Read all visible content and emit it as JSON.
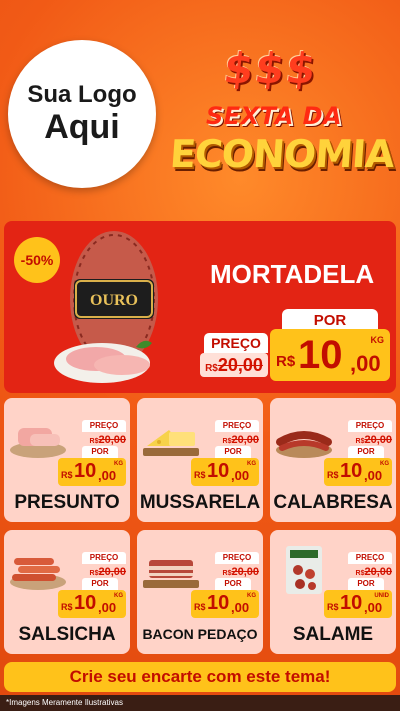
{
  "logo": {
    "line1": "Sua Logo",
    "line2": "Aqui"
  },
  "headline": {
    "symbols": [
      "$",
      "$",
      "$"
    ],
    "line1": "SEXTA DA",
    "line2": "ECONOMIA"
  },
  "hero": {
    "discount": "-50%",
    "brand": "OURO",
    "product": "MORTADELA",
    "preco_label": "PREÇO",
    "old_currency": "R$",
    "old_price": "20,00",
    "por_label": "POR",
    "currency": "R$",
    "price_int": "10",
    "price_cents": ",00",
    "unit": "KG"
  },
  "cards": [
    {
      "name": "PRESUNTO",
      "preco_label": "PREÇO",
      "old_currency": "R$",
      "old_price": "20,00",
      "por_label": "POR",
      "currency": "R$",
      "price_int": "10",
      "price_cents": ",00",
      "unit": "KG"
    },
    {
      "name": "MUSSARELA",
      "preco_label": "PREÇO",
      "old_currency": "R$",
      "old_price": "20,00",
      "por_label": "POR",
      "currency": "R$",
      "price_int": "10",
      "price_cents": ",00",
      "unit": "KG"
    },
    {
      "name": "CALABRESA",
      "preco_label": "PREÇO",
      "old_currency": "R$",
      "old_price": "20,00",
      "por_label": "POR",
      "currency": "R$",
      "price_int": "10",
      "price_cents": ",00",
      "unit": "KG"
    },
    {
      "name": "SALSICHA",
      "preco_label": "PREÇO",
      "old_currency": "R$",
      "old_price": "20,00",
      "por_label": "POR",
      "currency": "R$",
      "price_int": "10",
      "price_cents": ",00",
      "unit": "KG"
    },
    {
      "name": "BACON PEDAÇO",
      "preco_label": "PREÇO",
      "old_currency": "R$",
      "old_price": "20,00",
      "por_label": "POR",
      "currency": "R$",
      "price_int": "10",
      "price_cents": ",00",
      "unit": "KG"
    },
    {
      "name": "SALAME",
      "preco_label": "PREÇO",
      "old_currency": "R$",
      "old_price": "20,00",
      "por_label": "POR",
      "currency": "R$",
      "price_int": "10",
      "price_cents": ",00",
      "unit": "UNID"
    }
  ],
  "cta": "Crie seu encarte com este tema!",
  "footnote": "*Imagens Meramente Ilustrativas",
  "colors": {
    "background": "#f15a16",
    "hero": "#e32414",
    "card": "#ffd3c8",
    "price": "#ffc21a",
    "accent_red": "#c20d00"
  }
}
